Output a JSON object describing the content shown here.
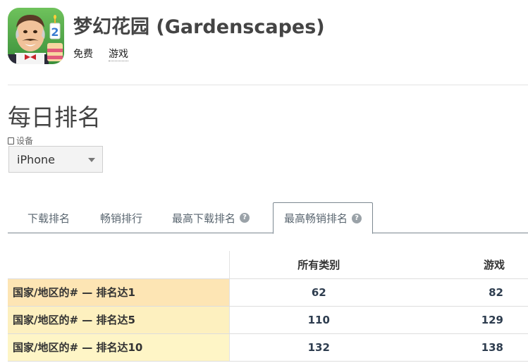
{
  "app": {
    "title": "梦幻花园 (Gardenscapes)",
    "price": "免费",
    "genre": "游戏",
    "icon": "gardenscapes-app-icon",
    "icon_badge": "2"
  },
  "section": {
    "title": "每日排名",
    "device_label": "设备",
    "device_value": "iPhone"
  },
  "tabs": [
    {
      "label": "下载排名",
      "help": false
    },
    {
      "label": "畅销排行",
      "help": false
    },
    {
      "label": "最高下载排名",
      "help": true
    },
    {
      "label": "最高畅销排名",
      "help": true,
      "active": true
    }
  ],
  "table": {
    "headers": [
      "",
      "所有类别",
      "游戏"
    ],
    "rows": [
      {
        "label": "国家/地区的# — 排名达1",
        "all": "62",
        "games": "82"
      },
      {
        "label": "国家/地区的# — 排名达5",
        "all": "110",
        "games": "129"
      },
      {
        "label": "国家/地区的# — 排名达10",
        "all": "132",
        "games": "138"
      }
    ]
  },
  "colors": {
    "row1_bg": "#fde5b4",
    "row2_bg": "#fdf0bf",
    "row3_bg": "#fef5c6",
    "tab_border": "#7c8891"
  }
}
